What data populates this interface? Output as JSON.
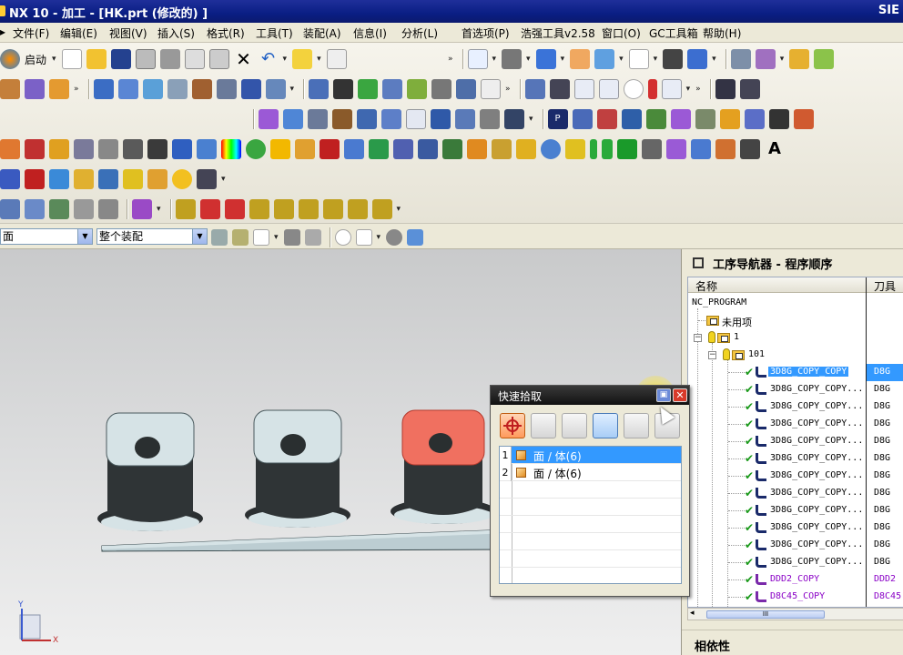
{
  "window": {
    "title": "NX 10 - 加工 - [HK.prt (修改的) ]",
    "brand": "SIE"
  },
  "menu": [
    "文件(F)",
    "编辑(E)",
    "视图(V)",
    "插入(S)",
    "格式(R)",
    "工具(T)",
    "装配(A)",
    "信息(I)",
    "分析(L)",
    "首选项(P)",
    "浩强工具v2.58",
    "窗口(O)",
    "GC工具箱",
    "帮助(H)"
  ],
  "toolbar": {
    "start_label": "启动"
  },
  "selection": {
    "filter_value": "面",
    "scope_value": "整个装配"
  },
  "navigator": {
    "title": "工序导航器 - 程序顺序",
    "col_name": "名称",
    "col_tool": "刀具",
    "root": "NC_PROGRAM",
    "unused": "未用项",
    "program_1": "1",
    "program_101": "101",
    "ops": [
      {
        "name": "3D8G_COPY_COPY",
        "tool": "D8G"
      },
      {
        "name": "3D8G_COPY_COPY...",
        "tool": "D8G"
      },
      {
        "name": "3D8G_COPY_COPY...",
        "tool": "D8G"
      },
      {
        "name": "3D8G_COPY_COPY...",
        "tool": "D8G"
      },
      {
        "name": "3D8G_COPY_COPY...",
        "tool": "D8G"
      },
      {
        "name": "3D8G_COPY_COPY...",
        "tool": "D8G"
      },
      {
        "name": "3D8G_COPY_COPY...",
        "tool": "D8G"
      },
      {
        "name": "3D8G_COPY_COPY...",
        "tool": "D8G"
      },
      {
        "name": "3D8G_COPY_COPY...",
        "tool": "D8G"
      },
      {
        "name": "3D8G_COPY_COPY...",
        "tool": "D8G"
      },
      {
        "name": "3D8G_COPY_COPY...",
        "tool": "D8G"
      },
      {
        "name": "3D8G_COPY_COPY...",
        "tool": "D8G"
      },
      {
        "name": "DDD2_COPY",
        "tool": "DDD2"
      },
      {
        "name": "D8C45_COPY",
        "tool": "D8C45"
      }
    ],
    "scroll_label": "III",
    "dependencies": "相依性"
  },
  "quick_pick": {
    "title": "快速拾取",
    "items": [
      {
        "index": "1",
        "text": "面 / 体(6)"
      },
      {
        "index": "2",
        "text": "面 / 体(6)"
      }
    ]
  },
  "colors": {
    "title_bar": "#0a1e84",
    "selection": "#3399ff",
    "highlight_face": "#f07060",
    "part": "#d6e3e6"
  }
}
